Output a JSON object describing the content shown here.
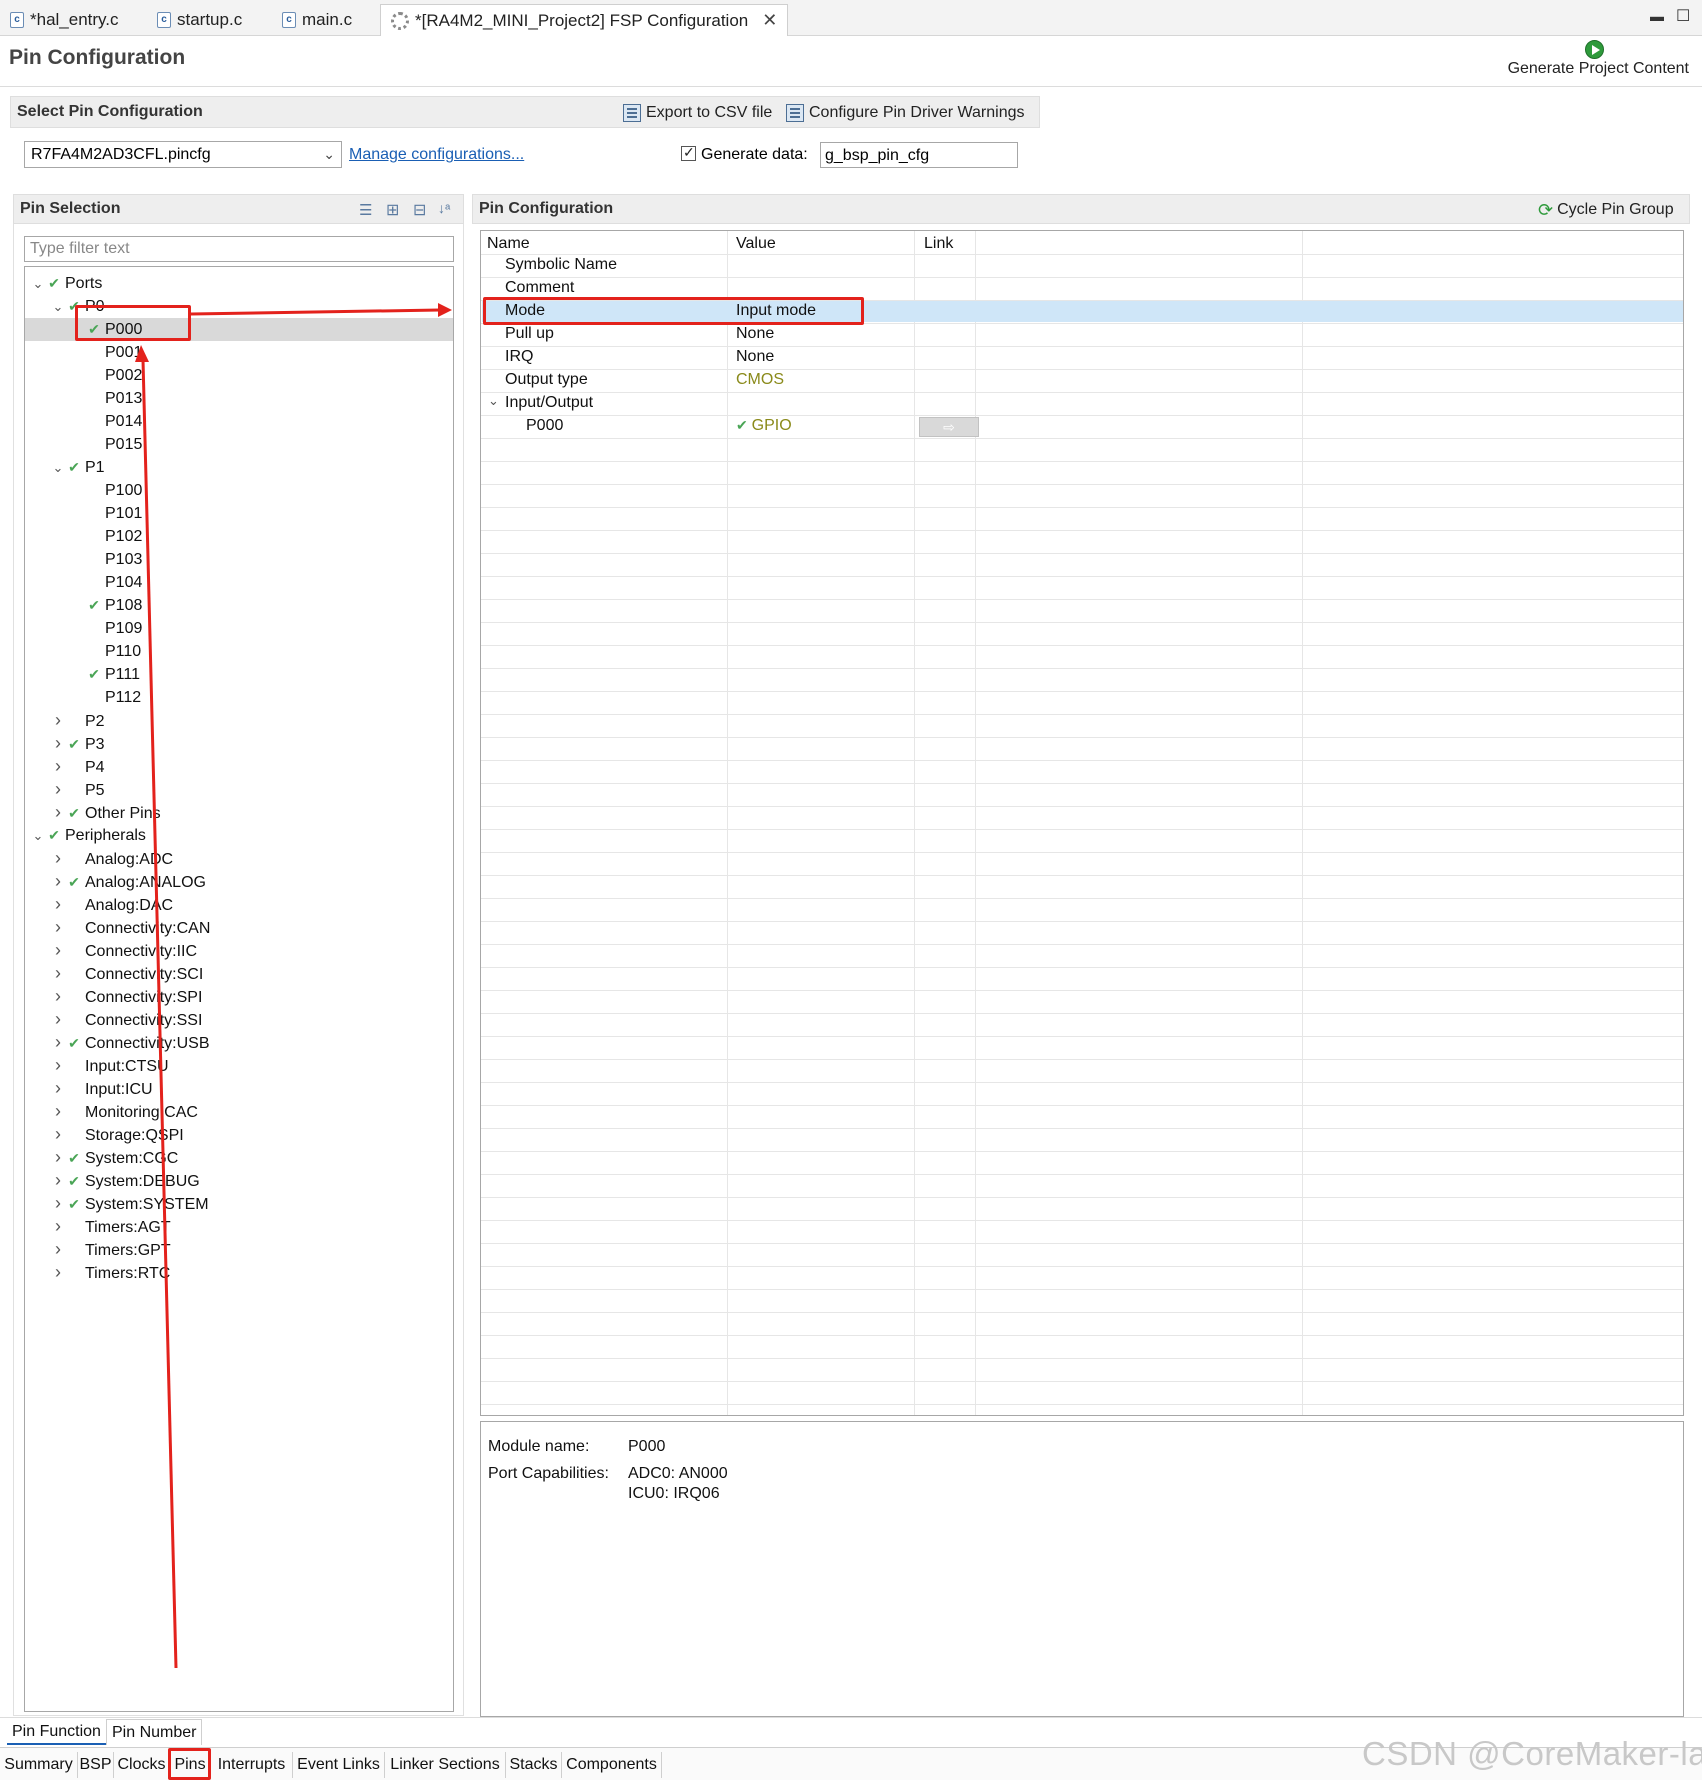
{
  "editor_tabs": [
    {
      "label": "*hal_entry.c"
    },
    {
      "label": "startup.c"
    },
    {
      "label": "main.c"
    },
    {
      "label": "*[RA4M2_MINI_Project2] FSP Configuration"
    }
  ],
  "page_title": "Pin Configuration",
  "generate_project_content": "Generate Project Content",
  "select_section": {
    "title": "Select Pin Configuration",
    "export_csv": "Export to CSV file",
    "configure_warnings": "Configure Pin Driver Warnings",
    "config_file": "R7FA4M2AD3CFL.pincfg",
    "manage_link": "Manage configurations...",
    "generate_data_label": "Generate data:",
    "generate_data_value": "g_bsp_pin_cfg"
  },
  "pin_selection": {
    "title": "Pin Selection",
    "filter_placeholder": "Type filter text",
    "tree": [
      {
        "label": "Ports",
        "level": 0,
        "expanded": true,
        "checked": true
      },
      {
        "label": "P0",
        "level": 1,
        "expanded": true,
        "checked": true
      },
      {
        "label": "P000",
        "level": 2,
        "checked": true,
        "selected": true
      },
      {
        "label": "P001",
        "level": 2
      },
      {
        "label": "P002",
        "level": 2
      },
      {
        "label": "P013",
        "level": 2
      },
      {
        "label": "P014",
        "level": 2
      },
      {
        "label": "P015",
        "level": 2
      },
      {
        "label": "P1",
        "level": 1,
        "expanded": true,
        "checked": true
      },
      {
        "label": "P100",
        "level": 2
      },
      {
        "label": "P101",
        "level": 2
      },
      {
        "label": "P102",
        "level": 2
      },
      {
        "label": "P103",
        "level": 2
      },
      {
        "label": "P104",
        "level": 2
      },
      {
        "label": "P108",
        "level": 2,
        "checked": true
      },
      {
        "label": "P109",
        "level": 2
      },
      {
        "label": "P110",
        "level": 2
      },
      {
        "label": "P111",
        "level": 2,
        "checked": true
      },
      {
        "label": "P112",
        "level": 2
      },
      {
        "label": "P2",
        "level": 1,
        "expanded": false
      },
      {
        "label": "P3",
        "level": 1,
        "expanded": false,
        "checked": true
      },
      {
        "label": "P4",
        "level": 1,
        "expanded": false
      },
      {
        "label": "P5",
        "level": 1,
        "expanded": false
      },
      {
        "label": "Other Pins",
        "level": 1,
        "expanded": false,
        "checked": true
      },
      {
        "label": "Peripherals",
        "level": 0,
        "expanded": true,
        "checked": true
      },
      {
        "label": "Analog:ADC",
        "level": 1,
        "expanded": false
      },
      {
        "label": "Analog:ANALOG",
        "level": 1,
        "expanded": false,
        "checked": true
      },
      {
        "label": "Analog:DAC",
        "level": 1,
        "expanded": false
      },
      {
        "label": "Connectivity:CAN",
        "level": 1,
        "expanded": false
      },
      {
        "label": "Connectivity:IIC",
        "level": 1,
        "expanded": false
      },
      {
        "label": "Connectivity:SCI",
        "level": 1,
        "expanded": false
      },
      {
        "label": "Connectivity:SPI",
        "level": 1,
        "expanded": false
      },
      {
        "label": "Connectivity:SSI",
        "level": 1,
        "expanded": false
      },
      {
        "label": "Connectivity:USB",
        "level": 1,
        "expanded": false,
        "checked": true
      },
      {
        "label": "Input:CTSU",
        "level": 1,
        "expanded": false
      },
      {
        "label": "Input:ICU",
        "level": 1,
        "expanded": false
      },
      {
        "label": "Monitoring:CAC",
        "level": 1,
        "expanded": false
      },
      {
        "label": "Storage:QSPI",
        "level": 1,
        "expanded": false
      },
      {
        "label": "System:CGC",
        "level": 1,
        "expanded": false,
        "checked": true
      },
      {
        "label": "System:DEBUG",
        "level": 1,
        "expanded": false,
        "checked": true
      },
      {
        "label": "System:SYSTEM",
        "level": 1,
        "expanded": false,
        "checked": true
      },
      {
        "label": "Timers:AGT",
        "level": 1,
        "expanded": false
      },
      {
        "label": "Timers:GPT",
        "level": 1,
        "expanded": false
      },
      {
        "label": "Timers:RTC",
        "level": 1,
        "expanded": false
      }
    ]
  },
  "pin_config": {
    "title": "Pin Configuration",
    "cycle_pin_group": "Cycle Pin Group",
    "columns": {
      "name": "Name",
      "value": "Value",
      "link": "Link"
    },
    "rows": [
      {
        "name": "Symbolic Name",
        "value": ""
      },
      {
        "name": "Comment",
        "value": ""
      },
      {
        "name": "Mode",
        "value": "Input mode"
      },
      {
        "name": "Pull up",
        "value": "None"
      },
      {
        "name": "IRQ",
        "value": "None"
      },
      {
        "name": "Output type",
        "value": "CMOS"
      },
      {
        "name": "Input/Output",
        "value": ""
      },
      {
        "name": "P000",
        "value": "GPIO"
      }
    ]
  },
  "details": {
    "module_name_label": "Module name:",
    "module_name_value": "P000",
    "port_cap_label": "Port Capabilities:",
    "port_cap_1": "ADC0: AN000",
    "port_cap_2": "ICU0: IRQ06"
  },
  "sub_tabs": [
    {
      "label": "Pin Function"
    },
    {
      "label": "Pin Number"
    }
  ],
  "bottom_tabs": [
    {
      "label": "Summary"
    },
    {
      "label": "BSP"
    },
    {
      "label": "Clocks"
    },
    {
      "label": "Pins"
    },
    {
      "label": "Interrupts"
    },
    {
      "label": "Event Links"
    },
    {
      "label": "Linker Sections"
    },
    {
      "label": "Stacks"
    },
    {
      "label": "Components"
    }
  ],
  "watermark": "CSDN @CoreMaker-lab",
  "colors": {
    "highlight": "#e3221c",
    "selection": "#cfe6f8",
    "check": "#4aa556"
  }
}
